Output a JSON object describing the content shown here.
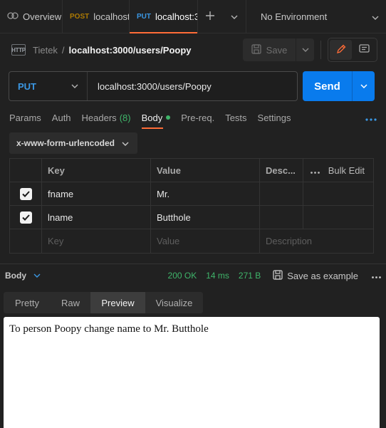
{
  "tabs": {
    "overview": "Overview",
    "tab1": {
      "method": "POST",
      "title": "localhost:"
    },
    "tab2": {
      "method": "PUT",
      "title": "localhost:3"
    },
    "environment": "No Environment"
  },
  "breadcrumb": {
    "collection": "Tietek",
    "separator": "/",
    "request": "localhost:3000/users/Poopy"
  },
  "toolbar": {
    "save_label": "Save"
  },
  "request": {
    "method": "PUT",
    "url": "localhost:3000/users/Poopy",
    "send_label": "Send"
  },
  "request_tabs": {
    "params": "Params",
    "auth": "Auth",
    "headers": "Headers",
    "headers_count": "(8)",
    "body": "Body",
    "prereq": "Pre-req.",
    "tests": "Tests",
    "settings": "Settings"
  },
  "body_type": "x-www-form-urlencoded",
  "params_table": {
    "headers": {
      "key": "Key",
      "value": "Value",
      "description": "Desc...",
      "bulk": "Bulk Edit"
    },
    "rows": [
      {
        "checked": true,
        "key": "fname",
        "value": "Mr."
      },
      {
        "checked": true,
        "key": "lname",
        "value": "Butthole"
      }
    ],
    "placeholders": {
      "key": "Key",
      "value": "Value",
      "description": "Description"
    }
  },
  "response": {
    "body_label": "Body",
    "status": "200 OK",
    "time": "14 ms",
    "size": "271 B",
    "save_example": "Save as example",
    "view_tabs": [
      "Pretty",
      "Raw",
      "Preview",
      "Visualize"
    ],
    "active_view": "Preview",
    "preview_text": "To person Poopy change name to Mr. Butthole"
  },
  "colors": {
    "accent": "#ff6c37",
    "send": "#097bed",
    "put": "#3b97e3",
    "post": "#ad7a03",
    "success": "#3fb56a"
  }
}
